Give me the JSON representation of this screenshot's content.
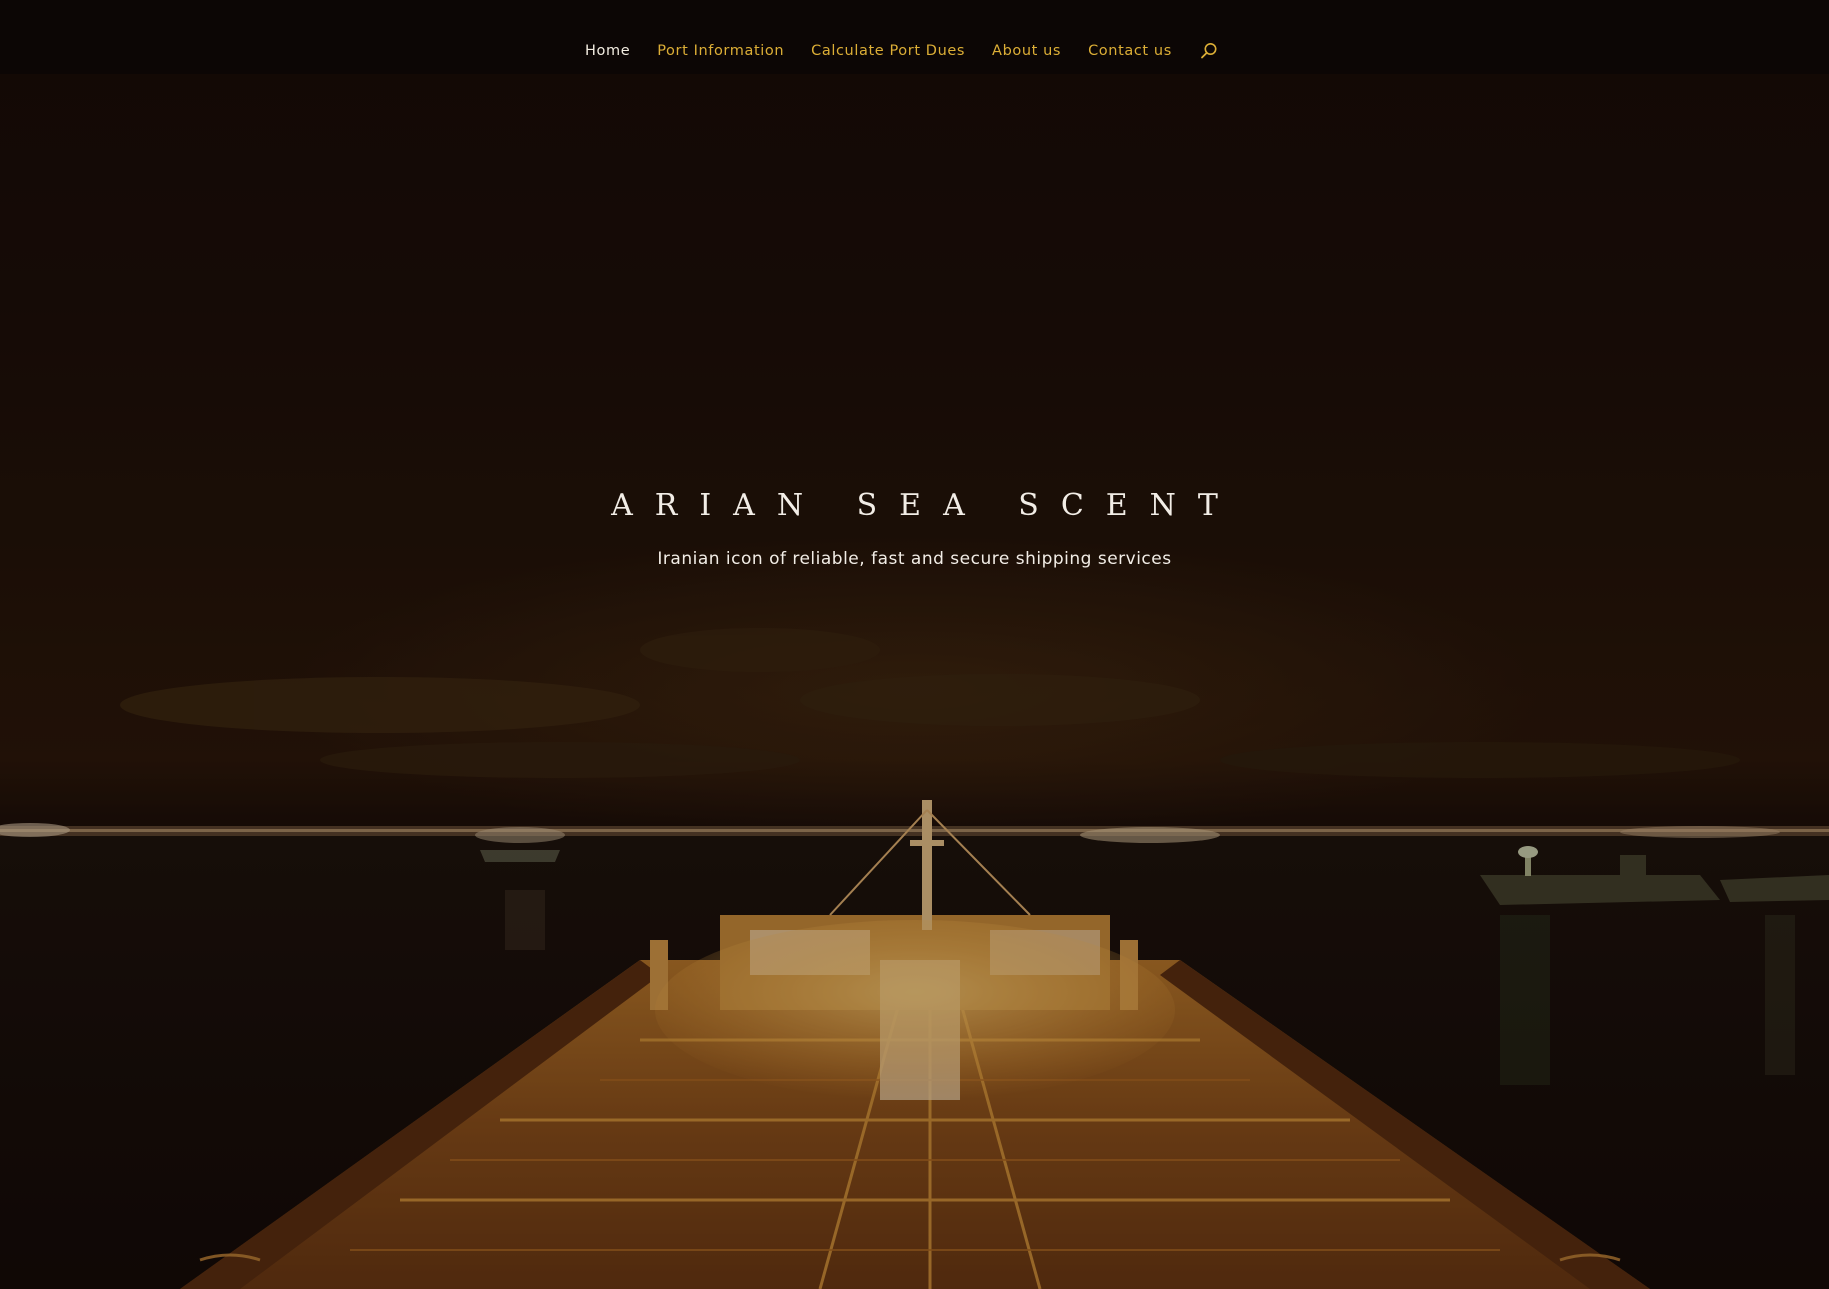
{
  "nav": {
    "items": [
      {
        "label": "Home",
        "active": true
      },
      {
        "label": "Port Information",
        "active": false
      },
      {
        "label": "Calculate Port Dues",
        "active": false
      },
      {
        "label": "About us",
        "active": false
      },
      {
        "label": "Contact us",
        "active": false
      }
    ],
    "search_icon": "search-icon"
  },
  "hero": {
    "title": "ARIAN SEA SCENT",
    "subtitle": "Iranian icon of reliable, fast and secure shipping services",
    "background": "night-harbor-tanker-photo"
  },
  "colors": {
    "nav_link": "#dcae36",
    "nav_active": "#f3ede2",
    "hero_text": "#f2ede6",
    "ship_glow": "#e8a93a"
  }
}
